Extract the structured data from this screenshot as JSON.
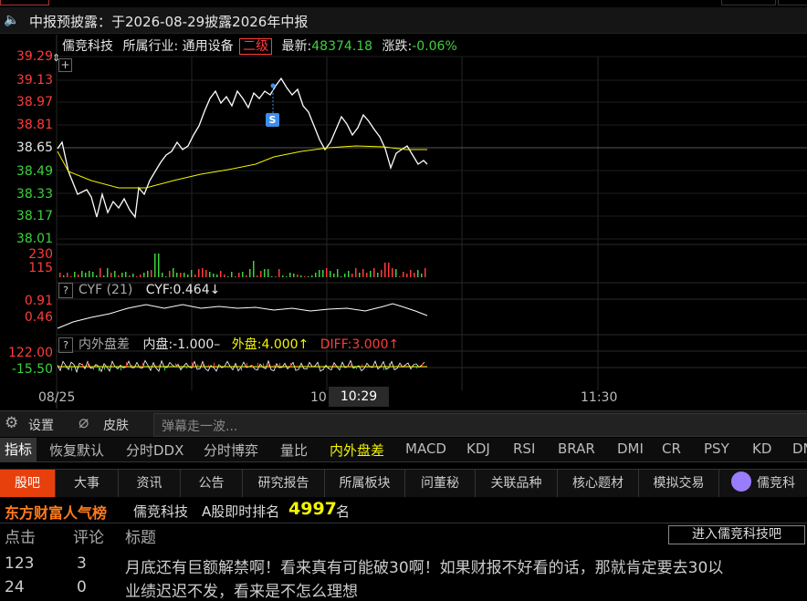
{
  "notice": {
    "icon": "speaker-icon",
    "text": "中报预披露：于2026-08-29披露2026年中报"
  },
  "stock": {
    "name": "儒竞科技",
    "industry_label": "所属行业:",
    "industry": "通用设备",
    "level": "二级",
    "latest_label": "最新:",
    "latest": "48374.18",
    "change_label": "涨跌:",
    "change": "-0.06%"
  },
  "price_axis": [
    "39.29",
    "39.13",
    "38.97",
    "38.81",
    "38.65",
    "38.49",
    "38.33",
    "38.17",
    "38.01"
  ],
  "volume_axis": [
    "230",
    "115"
  ],
  "cyf": {
    "title": "CYF (21)",
    "value": "CYF:0.464↓",
    "axis": [
      "0.91",
      "0.46"
    ]
  },
  "nwpc": {
    "title": "内外盘差",
    "inner": "内盘:-1.000–",
    "outer": "外盘:4.000↑",
    "diff": "DIFF:3.000↑",
    "axis": [
      "122.00",
      "-15.50"
    ]
  },
  "time_axis": {
    "start": "08/25",
    "mid": "10",
    "cursor": "10:29",
    "end": "11:30"
  },
  "marker": "S",
  "toolbar": {
    "settings": "设置",
    "skin": "皮肤",
    "danmu_placeholder": "弹幕走一波..."
  },
  "indicator_tabs": [
    "指标",
    "恢复默认",
    "分时DDX",
    "分时博弈",
    "量比",
    "内外盘差",
    "MACD",
    "KDJ",
    "RSI",
    "BRAR",
    "DMI",
    "CR",
    "PSY",
    "KD",
    "DM"
  ],
  "info_tabs": [
    "股吧",
    "大事",
    "资讯",
    "公告",
    "研究报告",
    "所属板块",
    "问董秘",
    "关联品种",
    "核心题材",
    "模拟交易",
    "儒竞科"
  ],
  "hot": {
    "brand": "东方财富人气榜",
    "stock": "儒竞科技",
    "rank_label": "A股即时排名",
    "rank": "4997",
    "unit": "名"
  },
  "list": {
    "headers": [
      "点击",
      "评论",
      "标题"
    ],
    "enter_btn": "进入儒竞科技吧",
    "rows": [
      {
        "clicks": "123",
        "comments": "3",
        "title": "月底还有巨额解禁啊！看来真有可能破30啊！如果财报不好看的话，那就肯定要去30以"
      },
      {
        "clicks": "24",
        "comments": "0",
        "title": "业绩迟迟不发，看来是不怎么理想"
      }
    ]
  },
  "colors": {
    "up": "#ff3c3c",
    "down": "#3cd23c",
    "avg": "#f5f500",
    "bg": "#000000"
  }
}
